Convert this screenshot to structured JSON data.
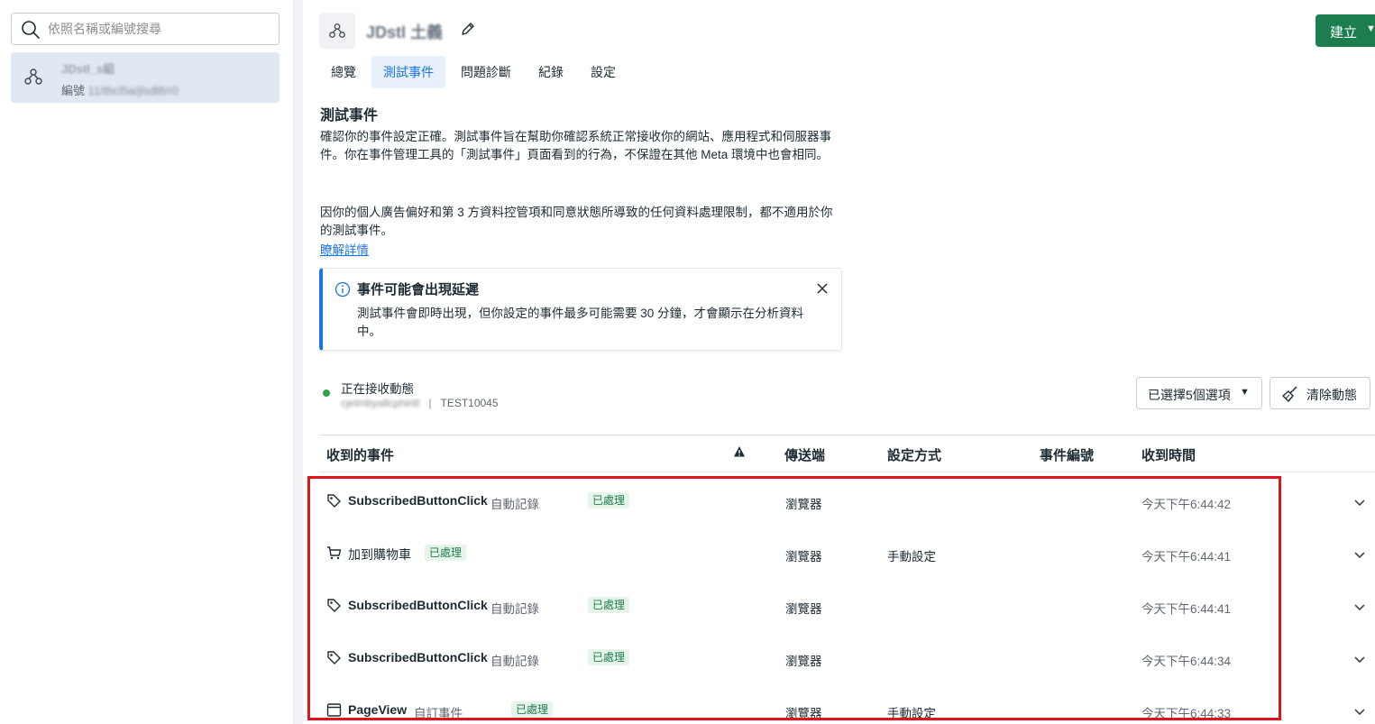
{
  "sidebar": {
    "search_placeholder": "依照名稱或編號搜尋",
    "item": {
      "name": "JDstl_s組",
      "id_prefix": "編號 ",
      "id_value": "11/thcl5a/jlsdl8/r0"
    }
  },
  "header": {
    "title": "JDstl 土義",
    "create_label": "建立"
  },
  "tabs": [
    "總覽",
    "測試事件",
    "問題診斷",
    "紀錄",
    "設定"
  ],
  "active_tab": "測試事件",
  "section": {
    "title": "測試事件",
    "para1": "確認你的事件設定正確。測試事件旨在幫助你確認系統正常接收你的網站、應用程式和伺服器事件。你在事件管理工具的「測試事件」頁面看到的行為，不保證在其他 Meta 環境中也會相同。",
    "para2": "因你的個人廣告偏好和第 3 方資料控管項和同意狀態所導致的任何資料處理限制，都不適用於你的測試事件。",
    "learn_more": "瞭解詳情"
  },
  "notice": {
    "title": "事件可能會出現延遲",
    "body": "測試事件會即時出現，但你設定的事件最多可能需要 30 分鐘，才會顯示在分析資料中。"
  },
  "status": {
    "label": "正在接收動態",
    "source": "cjelmbyallcphiritl",
    "test_code": "TEST10045",
    "status_color": "#31a24c"
  },
  "controls": {
    "select_label": "已選擇5個選項",
    "clear_label": "清除動態"
  },
  "table": {
    "headers": {
      "event": "收到的事件",
      "sender": "傳送端",
      "setup": "設定方式",
      "event_id": "事件編號",
      "received": "收到時間"
    },
    "rows": [
      {
        "icon": "tag-icon",
        "name": "SubscribedButtonClick",
        "type": "自動記錄",
        "badge": "已處理",
        "sender": "瀏覽器",
        "setup": "",
        "event_id": "",
        "time": "今天下午6:44:42"
      },
      {
        "icon": "cart-icon",
        "name": "加到購物車",
        "type": "",
        "badge": "已處理",
        "sender": "瀏覽器",
        "setup": "手動設定",
        "event_id": "",
        "time": "今天下午6:44:41"
      },
      {
        "icon": "tag-icon",
        "name": "SubscribedButtonClick",
        "type": "自動記錄",
        "badge": "已處理",
        "sender": "瀏覽器",
        "setup": "",
        "event_id": "",
        "time": "今天下午6:44:41"
      },
      {
        "icon": "tag-icon",
        "name": "SubscribedButtonClick",
        "type": "自動記錄",
        "badge": "已處理",
        "sender": "瀏覽器",
        "setup": "",
        "event_id": "",
        "time": "今天下午6:44:34"
      },
      {
        "icon": "window-icon",
        "name": "PageView",
        "type": "自訂事件",
        "badge": "已處理",
        "sender": "瀏覽器",
        "setup": "手動設定",
        "event_id": "",
        "time": "今天下午6:44:33"
      }
    ]
  },
  "colors": {
    "accent": "#1b74e4",
    "brand_green": "#1e7d4f",
    "highlight": "#e1141e"
  }
}
